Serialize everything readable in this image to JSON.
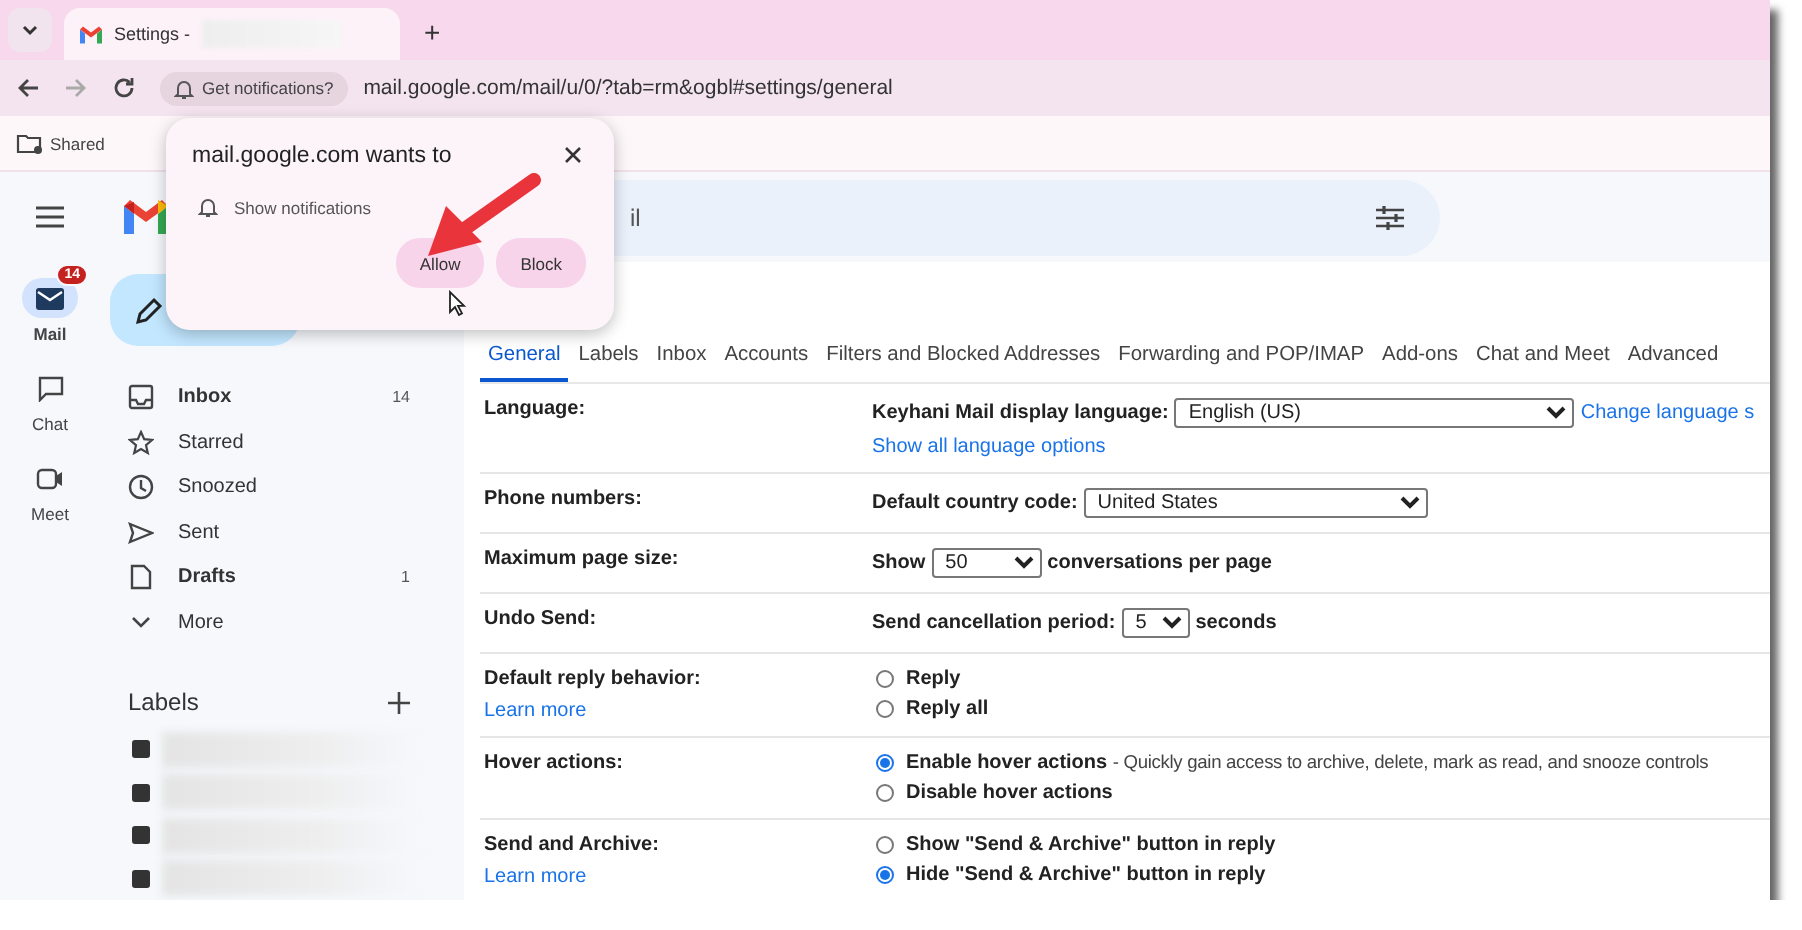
{
  "browser": {
    "tab": {
      "title": "Settings -",
      "title_blurred": true
    },
    "new_tab": "+",
    "notification_chip": "Get notifications?",
    "url": "mail.google.com/mail/u/0/?tab=rm&ogbl#settings/general",
    "bookmarks": [
      {
        "label": "Shared"
      }
    ]
  },
  "rail": [
    {
      "label": "Mail",
      "badge": "14",
      "selected": true
    },
    {
      "label": "Chat",
      "selected": false
    },
    {
      "label": "Meet",
      "selected": false
    }
  ],
  "search": {
    "visible_text": "il"
  },
  "nav": [
    {
      "label": "Inbox",
      "count": "14",
      "unread": true
    },
    {
      "label": "Starred",
      "unread": false
    },
    {
      "label": "Snoozed",
      "unread": false
    },
    {
      "label": "Sent",
      "unread": false
    },
    {
      "label": "Drafts",
      "count": "1",
      "unread": true
    },
    {
      "label": "More",
      "unread": false
    }
  ],
  "labels": {
    "title": "Labels",
    "items": [
      {
        "blurred": true
      },
      {
        "blurred": true
      },
      {
        "blurred": true
      },
      {
        "blurred": true
      }
    ]
  },
  "settings_tabs": [
    {
      "label": "General",
      "selected": true
    },
    {
      "label": "Labels",
      "selected": false
    },
    {
      "label": "Inbox",
      "selected": false
    },
    {
      "label": "Accounts",
      "selected": false
    },
    {
      "label": "Filters and Blocked Addresses",
      "selected": false
    },
    {
      "label": "Forwarding and POP/IMAP",
      "selected": false
    },
    {
      "label": "Add-ons",
      "selected": false
    },
    {
      "label": "Chat and Meet",
      "selected": false
    },
    {
      "label": "Advanced",
      "selected": false
    }
  ],
  "settings": [
    {
      "label": "Language:",
      "lines": [
        {
          "kind": "line",
          "parts": [
            {
              "kind": "text",
              "text": "Keyhani Mail display language:"
            },
            {
              "kind": "select",
              "value": "English (US)"
            },
            {
              "kind": "link",
              "text": "Change language s"
            }
          ]
        },
        {
          "kind": "line",
          "parts": [
            {
              "kind": "link",
              "text": "Show all language options"
            }
          ]
        }
      ]
    },
    {
      "label": "Phone numbers:",
      "lines": [
        {
          "kind": "line",
          "parts": [
            {
              "kind": "text",
              "text": "Default country code:"
            },
            {
              "kind": "select",
              "value": "United States"
            }
          ]
        }
      ]
    },
    {
      "label": "Maximum page size:",
      "lines": [
        {
          "kind": "line",
          "parts": [
            {
              "kind": "text",
              "text": "Show"
            },
            {
              "kind": "select",
              "value": "50"
            },
            {
              "kind": "text",
              "text": "conversations per page"
            }
          ]
        }
      ]
    },
    {
      "label": "Undo Send:",
      "lines": [
        {
          "kind": "line",
          "parts": [
            {
              "kind": "text",
              "text": "Send cancellation period:"
            },
            {
              "kind": "select",
              "value": "5"
            },
            {
              "kind": "text",
              "text": "seconds"
            }
          ]
        }
      ]
    },
    {
      "label": "Default reply behavior:",
      "link": "Learn more",
      "lines": [
        {
          "kind": "radio",
          "label": "Reply",
          "checked": false
        },
        {
          "kind": "radio",
          "label": "Reply all",
          "checked": false
        }
      ]
    },
    {
      "label": "Hover actions:",
      "lines": [
        {
          "kind": "radio",
          "label": "Enable hover actions",
          "description": "- Quickly gain access to archive, delete, mark as read, and snooze controls",
          "checked": true
        },
        {
          "kind": "radio",
          "label": "Disable hover actions",
          "checked": false
        }
      ]
    },
    {
      "label": "Send and Archive:",
      "link": "Learn more",
      "lines": [
        {
          "kind": "radio",
          "label": "Show \"Send & Archive\" button in reply",
          "checked": false
        },
        {
          "kind": "radio",
          "label": "Hide \"Send & Archive\" button in reply",
          "checked": true
        }
      ]
    }
  ],
  "popup": {
    "title": "mail.google.com wants to",
    "permission": "Show notifications",
    "buttons": [
      {
        "label": "Allow"
      },
      {
        "label": "Block"
      }
    ]
  }
}
